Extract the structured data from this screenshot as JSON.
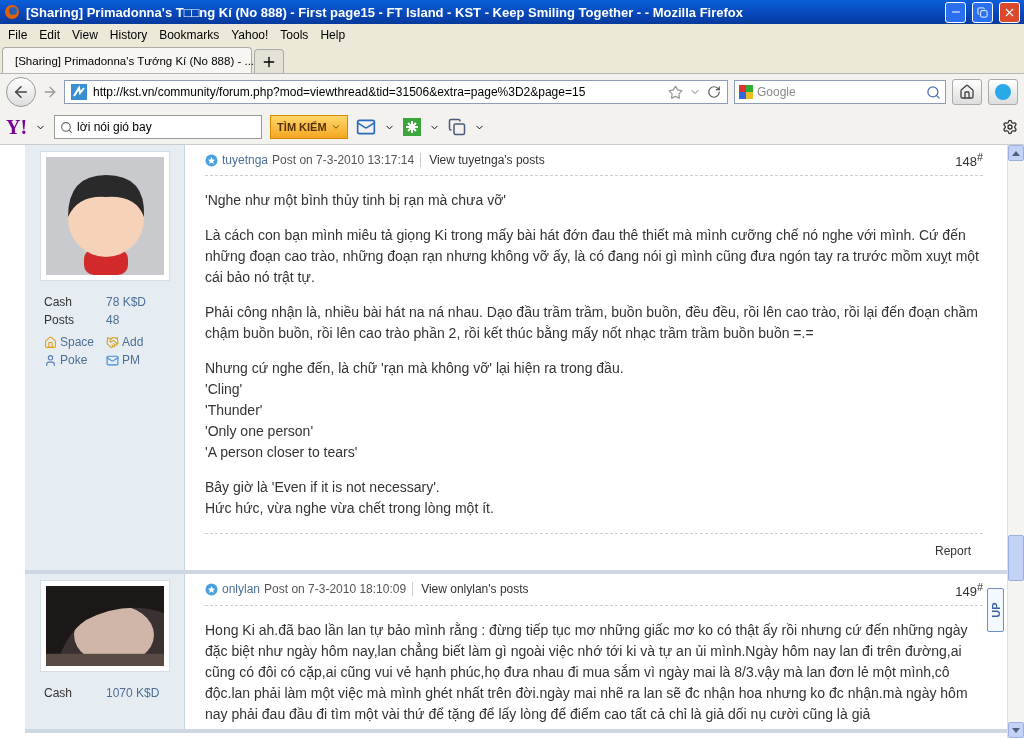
{
  "window": {
    "title": "[Sharing] Primadonna's T□□ng Kí (No 888) - First page15 - FT Island - KST - Keep Smiling Together - - Mozilla Firefox"
  },
  "menu": [
    "File",
    "Edit",
    "View",
    "History",
    "Bookmarks",
    "Yahoo!",
    "Tools",
    "Help"
  ],
  "tabs": [
    {
      "label": "[Sharing] Primadonna's Tướng Kí (No 888) - ...",
      "selected": true
    }
  ],
  "nav": {
    "url": "http://kst.vn/community/forum.php?mod=viewthread&tid=31506&extra=page%3D2&page=15",
    "search_placeholder": "Google"
  },
  "yahoo_toolbar": {
    "logo": "Y!",
    "search_value": "lời nói gió bay",
    "search_button": "TÌM KIẾM"
  },
  "posts": [
    {
      "avatar": {
        "kind": "drawing"
      },
      "author": "tuyetnga",
      "posted": "Post on 7-3-2010 13:17:14",
      "view_link": "View tuyetnga's posts",
      "number": "148",
      "number_mark": "#",
      "stats": [
        {
          "label": "Cash",
          "value": "78 K$D"
        },
        {
          "label": "Posts",
          "value": "48"
        }
      ],
      "actions": [
        {
          "kind": "space",
          "label": "Space"
        },
        {
          "kind": "add",
          "label": "Add"
        },
        {
          "kind": "poke",
          "label": "Poke"
        },
        {
          "kind": "pm",
          "label": "PM"
        }
      ],
      "paragraphs": [
        [
          "'Nghe như một bình thủy tinh bị rạn mà chưa vỡ'"
        ],
        [
          "Là cách con bạn mình miêu tả giọng Ki trong mấy bài hát đớn đau thê thiết mà mình cưỡng chế nó nghe với mình. Cứ đến những đoạn cao trào, những đoạn rạn nhưng không vỡ ấy, là có đang nói gì mình cũng đưa ngón tay ra trước mồm xuỵt một cái bảo nó trật tự."
        ],
        [
          "Phải công nhận là, nhiều bài hát na ná nhau. Dạo đầu trầm trầm, buồn buồn, đều đều, rồi lên cao trào, rồi lại đến đoạn chầm chậm buồn buồn, rồi lên cao trào phần 2, rồi kết thúc bằng mấy nốt nhạc trầm trầm buồn buồn =.="
        ],
        [
          "Nhưng cứ nghe đến, là chữ 'rạn mà không vỡ' lại hiện ra trong đầu.",
          "'Cling'",
          "'Thunder'",
          "'Only one person'",
          "'A person closer to tears'"
        ],
        [
          "Bây giờ là 'Even if it is not necessary'.",
          "Hức hức, vừa nghe vừa chết trong lòng một ít."
        ]
      ],
      "report": "Report"
    },
    {
      "avatar": {
        "kind": "picture"
      },
      "author": "onlylan",
      "posted": "Post on 7-3-2010 18:10:09",
      "view_link": "View onlylan's posts",
      "number": "149",
      "number_mark": "#",
      "stats": [
        {
          "label": "Cash",
          "value": "1070 K$D"
        }
      ],
      "paragraphs": [
        [
          "Hong Ki ah.đã bao lần lan tự bảo mình rằng : đừng tiếp tục mơ những giấc mơ ko có thật ấy rồi nhưng cứ đến những ngày đặc biệt như ngày hôm nay,lan chẳng biết làm gì ngoài việc nhớ tới ki và tự an ủi mình.Ngày hôm nay lan đi trên đường,ai cũng có đôi có cặp,ai cũng vui vẻ hạnh phúc,họ đưa nhau đi mua sắm vì ngày mai là 8/3.vậy mà lan đơn lẻ một mình,cô độc.lan phải làm một việc mà mình ghét nhất trên đời.ngày mai nhẽ ra lan sẽ đc nhận hoa nhưng ko đc nhận.mà ngày hôm nay phải đau đầu đi tìm một vài thứ để tặng để lấy lòng để điểm cao tất cả chỉ là giả dối nụ cười cũng là giả"
        ]
      ]
    }
  ],
  "back_to_top": "UP"
}
